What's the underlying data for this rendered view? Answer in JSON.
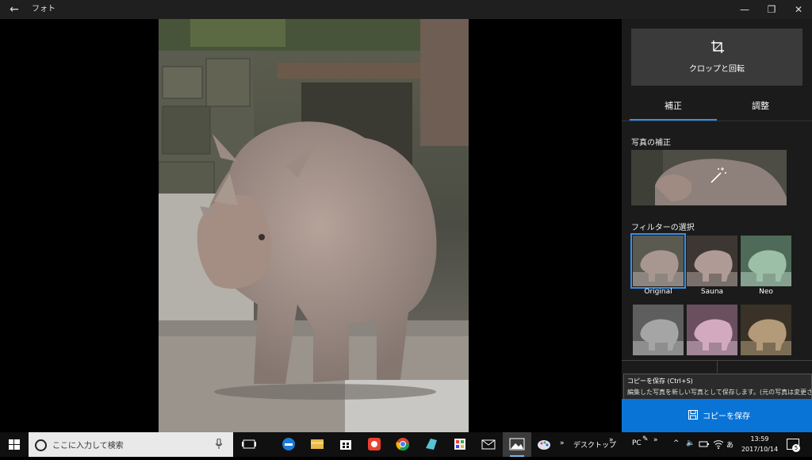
{
  "window": {
    "title": "フォト",
    "back_icon": "back-arrow-icon",
    "min_glyph": "—",
    "max_glyph": "❐",
    "close_glyph": "✕"
  },
  "panel": {
    "crop_label": "クロップと回転",
    "tabs": [
      "補正",
      "調整"
    ],
    "enhance_heading": "写真の補正",
    "filter_heading": "フィルターの選択",
    "filters": [
      {
        "name": "Original",
        "selected": true
      },
      {
        "name": "Sauna",
        "selected": false
      },
      {
        "name": "Neo",
        "selected": false
      },
      {
        "name": "",
        "selected": false
      },
      {
        "name": "",
        "selected": false
      },
      {
        "name": "",
        "selected": false
      }
    ],
    "accent": "#3a8ee6"
  },
  "tooltip": {
    "title": "コピーを保存 (Ctrl+S)",
    "description": "編集した写真を新しい写真として保存します。(元の写真は変更さ"
  },
  "save_button": {
    "label": "コピーを保存",
    "color": "#0a74d6"
  },
  "taskbar": {
    "search_placeholder": "ここに入力して検索",
    "desktop_label": "デスクトップ",
    "chevron": "»",
    "pc_label": "PC",
    "ime_label": "あ",
    "time": "13:59",
    "date": "2017/10/14",
    "notification_count": "5"
  }
}
